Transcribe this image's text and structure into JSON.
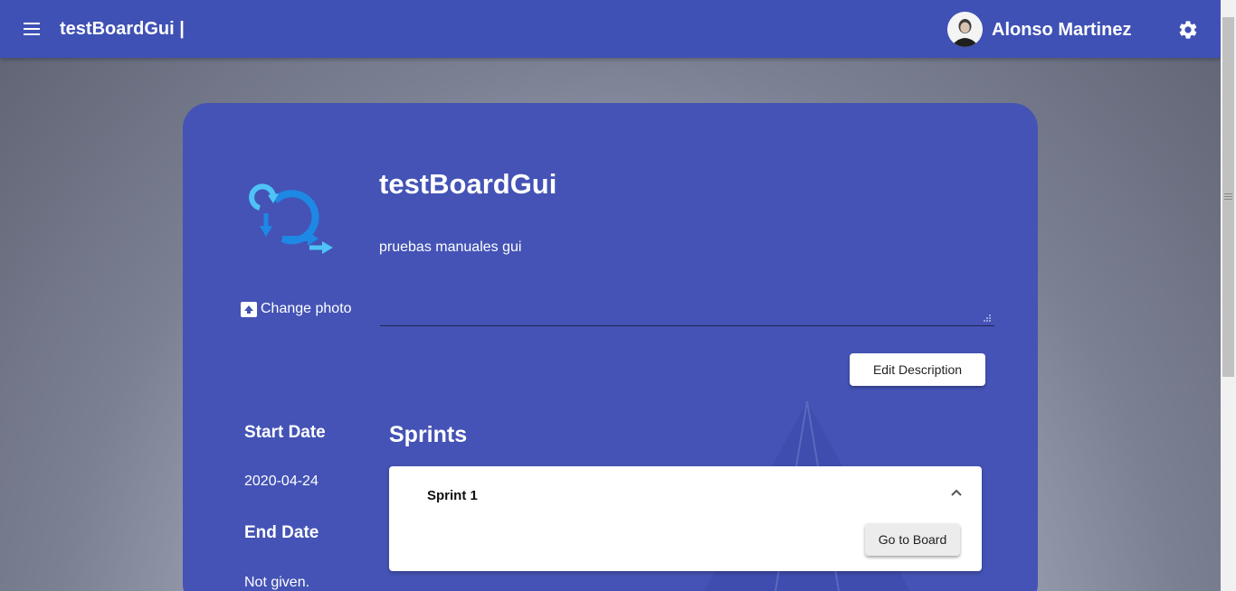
{
  "header": {
    "app_title": "testBoardGui |",
    "username": "Alonso Martinez",
    "icons": {
      "menu": "hamburger-menu-icon",
      "settings": "gear-icon"
    }
  },
  "board": {
    "title": "testBoardGui",
    "description": "pruebas manuales gui",
    "change_photo_label": "Change photo",
    "edit_description_label": "Edit Description"
  },
  "dates": {
    "start_label": "Start Date",
    "start_value": "2020-04-24",
    "end_label": "End Date",
    "end_value": "Not given."
  },
  "sprints": {
    "heading": "Sprints",
    "items": [
      {
        "name": "Sprint 1",
        "action_label": "Go to Board"
      }
    ]
  },
  "colors": {
    "primary": "#3f51b5",
    "card": "#4453b5",
    "logo_blue": "#1e88e5",
    "logo_light": "#4fc3f7"
  }
}
